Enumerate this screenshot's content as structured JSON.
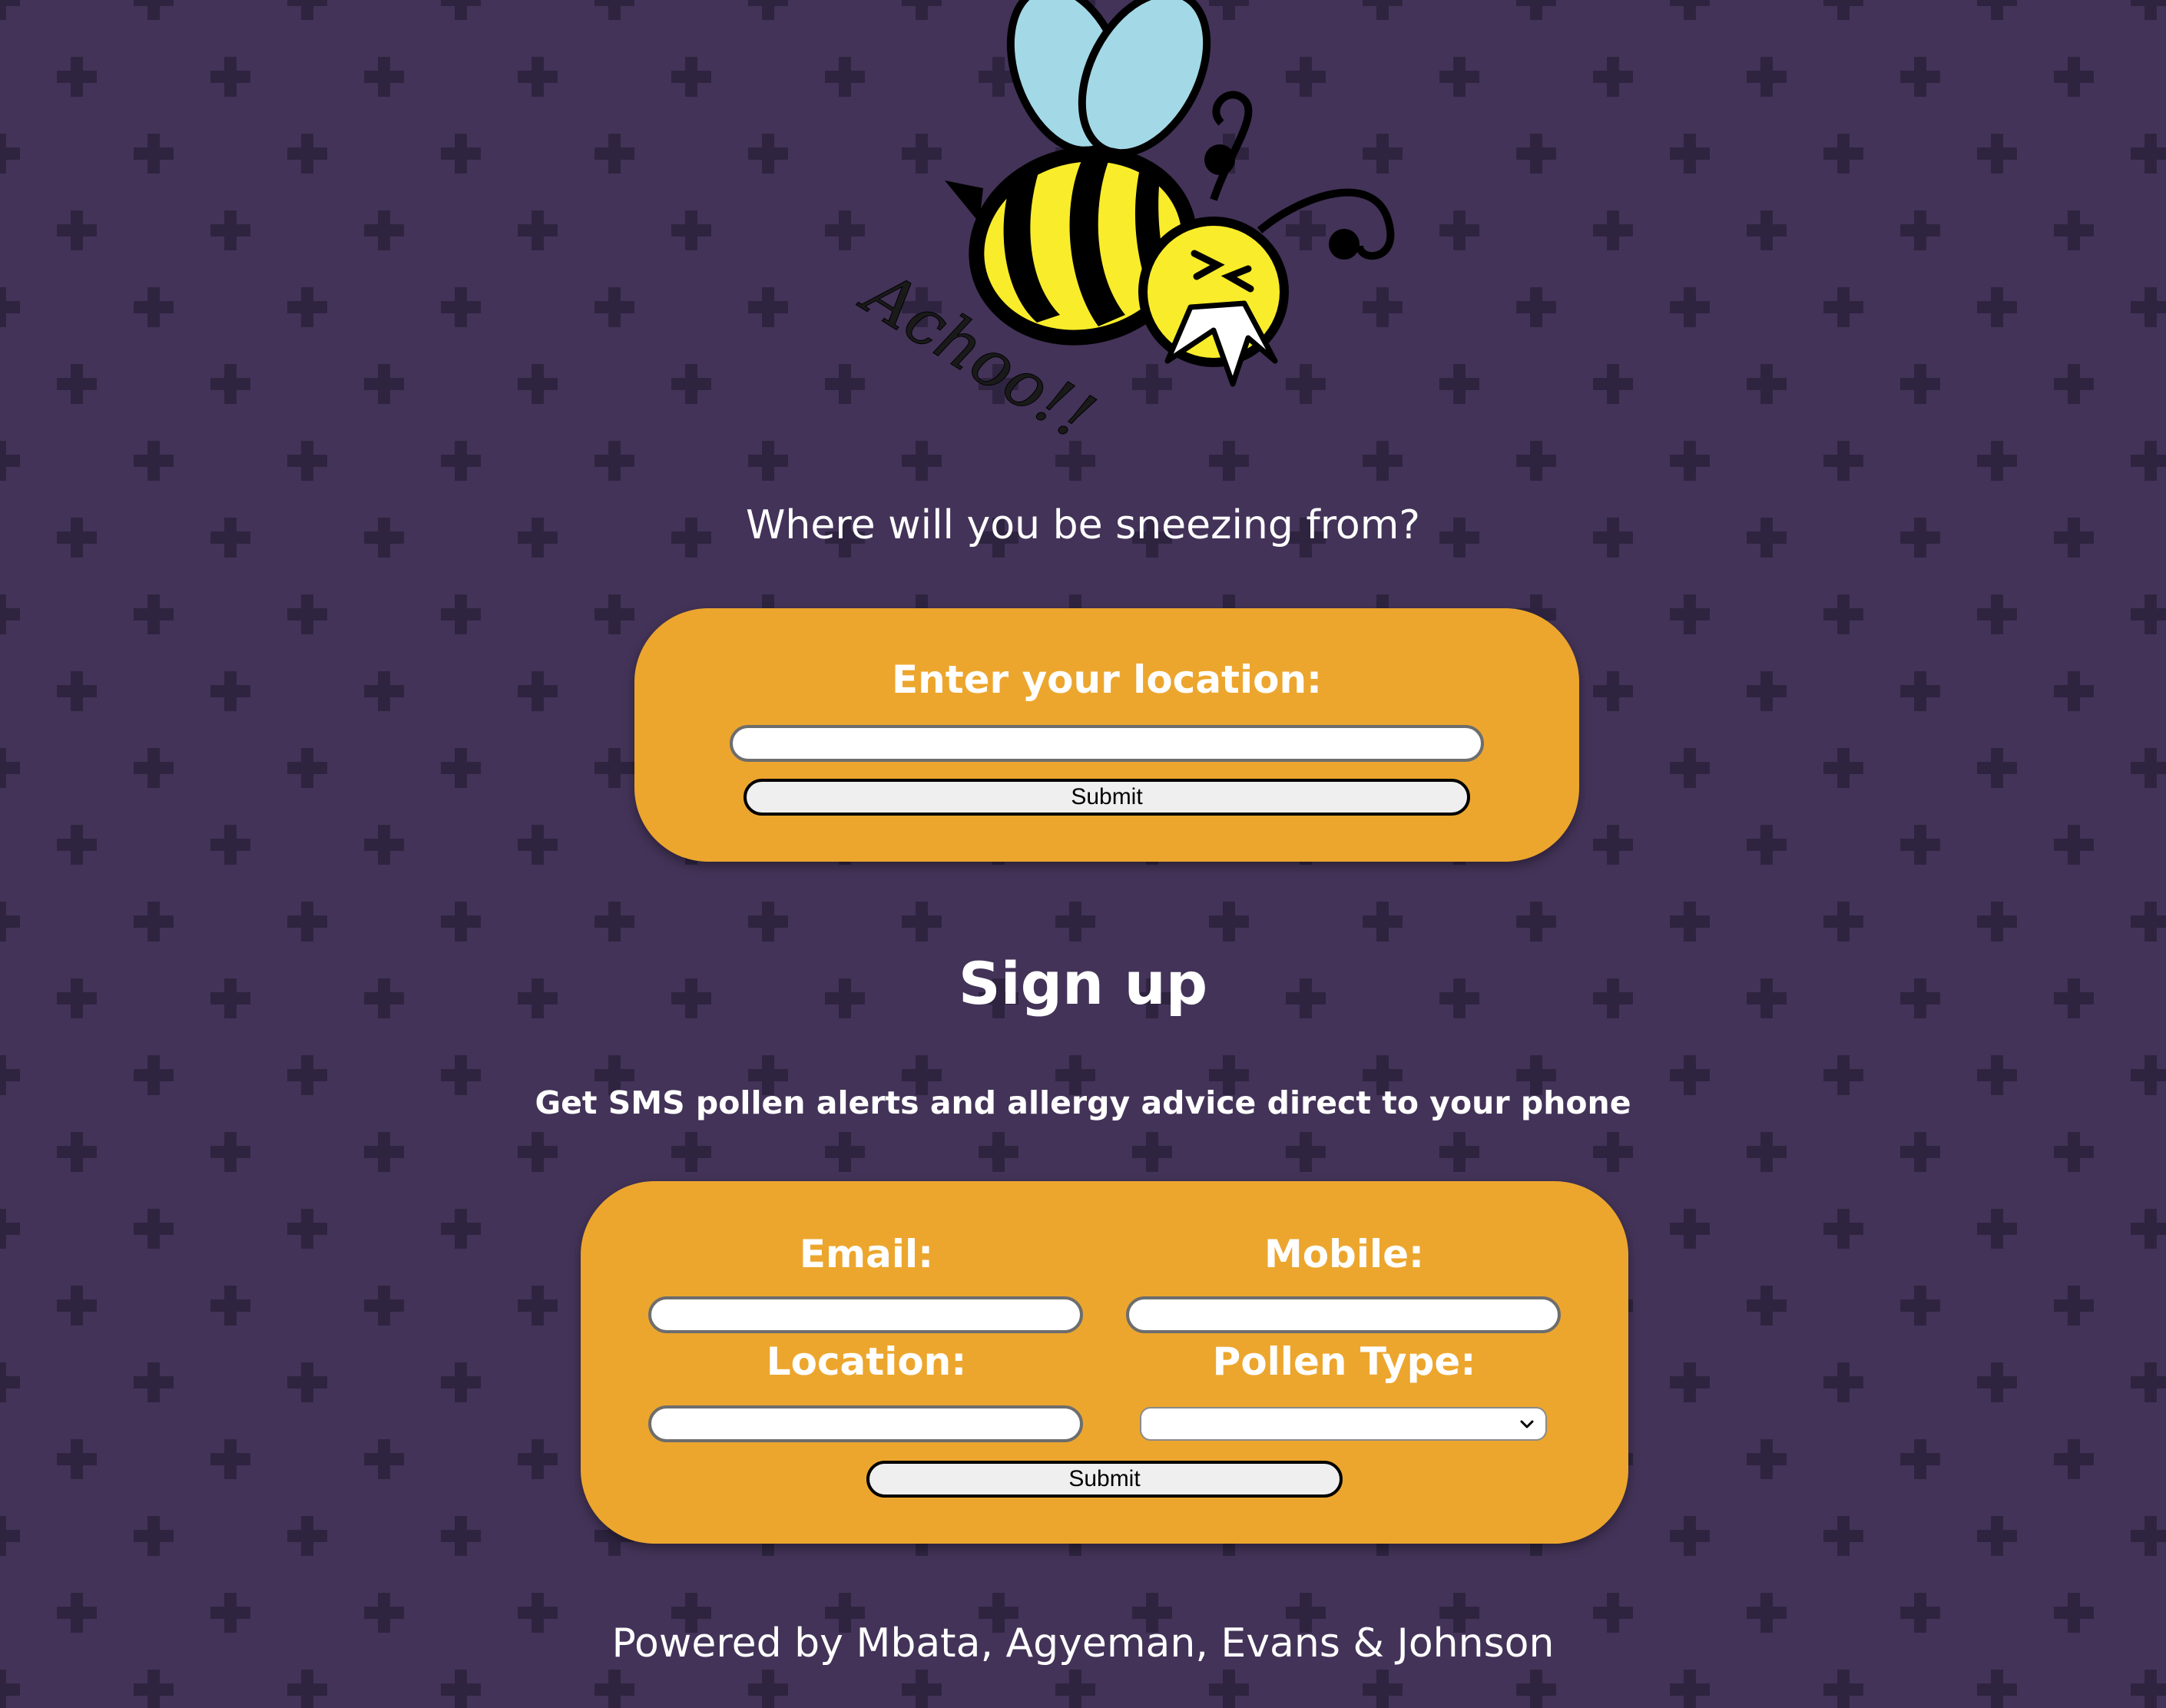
{
  "page": {
    "background_color": "#433358",
    "pattern_color": "#2e2440",
    "card_color": "#eca62e"
  },
  "logo": {
    "icon": "sneezing-bee-icon",
    "text": "Achoo!!"
  },
  "tagline": "Where will you be sneezing from?",
  "location_form": {
    "label": "Enter your location:",
    "input_value": "",
    "submit_label": "Submit"
  },
  "signup": {
    "heading": "Sign up",
    "subheading": "Get SMS pollen alerts and allergy advice direct to your phone",
    "email_label": "Email:",
    "email_value": "",
    "mobile_label": "Mobile:",
    "mobile_value": "",
    "location_label": "Location:",
    "location_value": "",
    "pollen_label": "Pollen Type:",
    "pollen_selected": "",
    "submit_label": "Submit"
  },
  "footer": "Powered by Mbata, Agyeman, Evans & Johnson"
}
